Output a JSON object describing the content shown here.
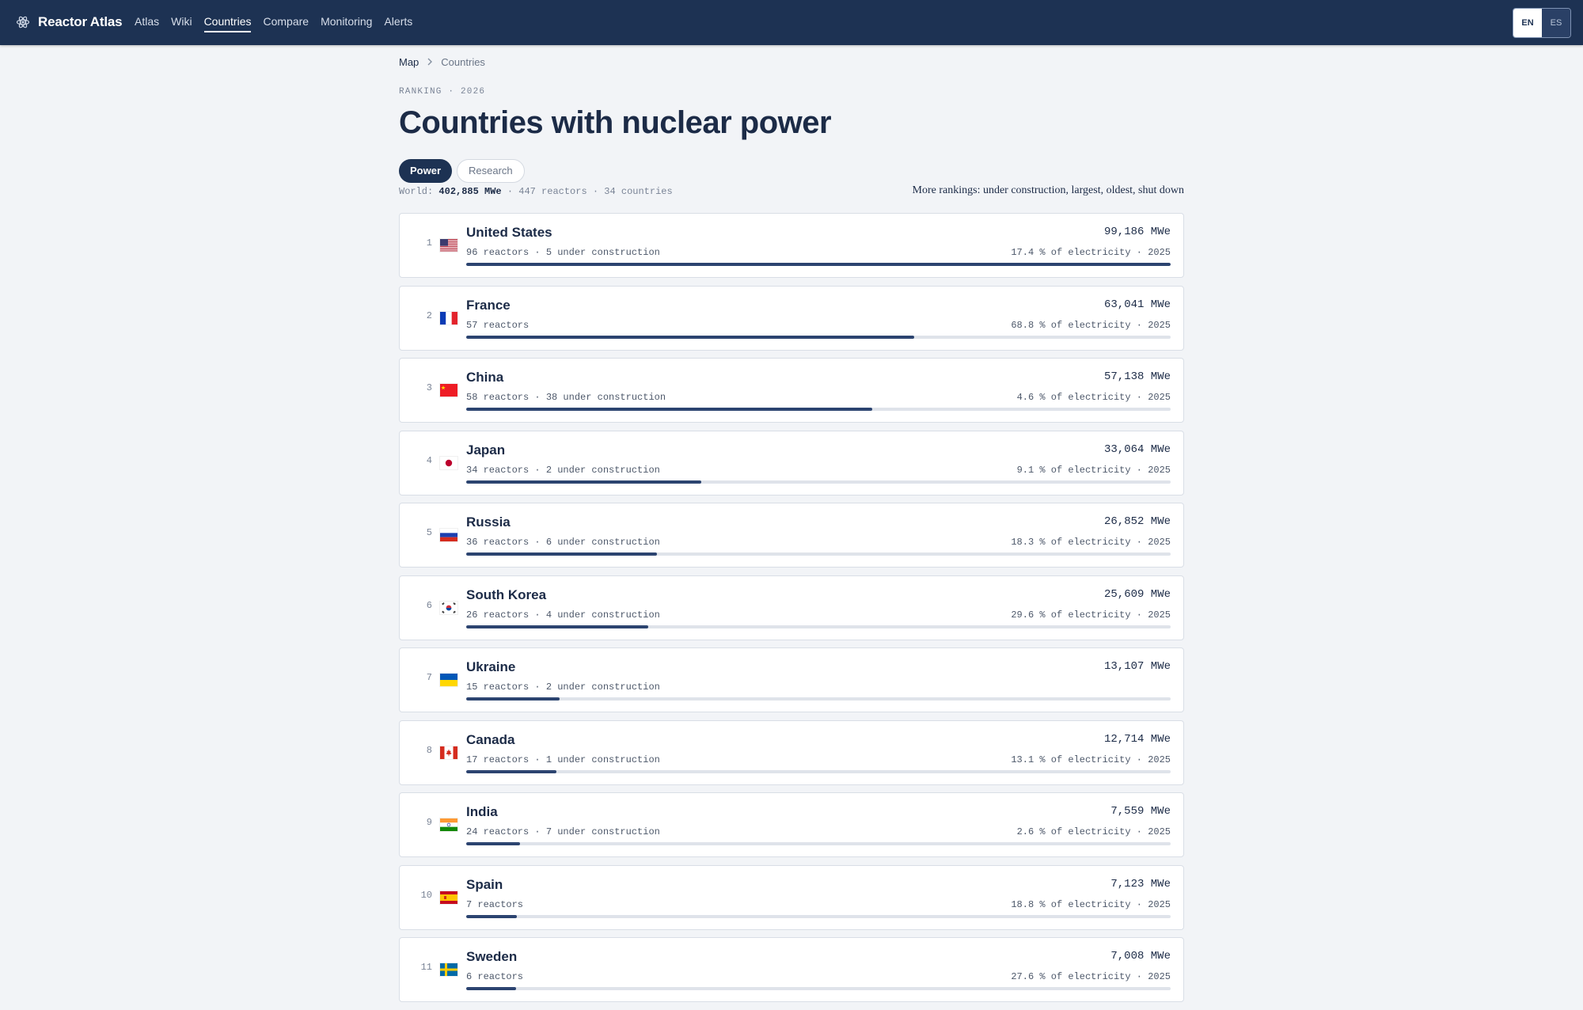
{
  "app": {
    "name": "Reactor Atlas",
    "logo_icon": "atom-icon"
  },
  "nav": [
    {
      "label": "Atlas",
      "active": false
    },
    {
      "label": "Wiki",
      "active": false
    },
    {
      "label": "Countries",
      "active": true
    },
    {
      "label": "Compare",
      "active": false
    },
    {
      "label": "Monitoring",
      "active": false
    },
    {
      "label": "Alerts",
      "active": false
    }
  ],
  "lang": {
    "selected": "EN",
    "other": "ES"
  },
  "breadcrumb": {
    "home": "Map",
    "current": "Countries"
  },
  "eyebrow": "RANKING · 2026",
  "title": "Countries with nuclear power",
  "tabs": [
    {
      "label": "Power",
      "active": true
    },
    {
      "label": "Research",
      "active": false
    }
  ],
  "world": {
    "prefix": "World: ",
    "total": "402,885 MWe",
    "rest": " · 447 reactors · 34 countries"
  },
  "more_rankings": "More rankings: under construction, largest, oldest, shut down",
  "colors": {
    "navbar": "#1d3253",
    "bar_fill": "#2c4470",
    "bar_track": "#dfe3ea",
    "background": "#f2f4f7"
  },
  "countries": [
    {
      "rank": "1",
      "name": "United States",
      "flag": "us",
      "mwe": "99,186 MWe",
      "reactors": "96 reactors · 5 under construction",
      "share": "17.4 % of electricity · 2025",
      "fraction": 1.0
    },
    {
      "rank": "2",
      "name": "France",
      "flag": "fr",
      "mwe": "63,041 MWe",
      "reactors": "57 reactors",
      "share": "68.8 % of electricity · 2025",
      "fraction": 0.6356
    },
    {
      "rank": "3",
      "name": "China",
      "flag": "cn",
      "mwe": "57,138 MWe",
      "reactors": "58 reactors · 38 under construction",
      "share": "4.6 % of electricity · 2025",
      "fraction": 0.5761
    },
    {
      "rank": "4",
      "name": "Japan",
      "flag": "jp",
      "mwe": "33,064 MWe",
      "reactors": "34 reactors · 2 under construction",
      "share": "9.1 % of electricity · 2025",
      "fraction": 0.3334
    },
    {
      "rank": "5",
      "name": "Russia",
      "flag": "ru",
      "mwe": "26,852 MWe",
      "reactors": "36 reactors · 6 under construction",
      "share": "18.3 % of electricity · 2025",
      "fraction": 0.2707
    },
    {
      "rank": "6",
      "name": "South Korea",
      "flag": "kr",
      "mwe": "25,609 MWe",
      "reactors": "26 reactors · 4 under construction",
      "share": "29.6 % of electricity · 2025",
      "fraction": 0.2582
    },
    {
      "rank": "7",
      "name": "Ukraine",
      "flag": "ua",
      "mwe": "13,107 MWe",
      "reactors": "15 reactors · 2 under construction",
      "share": "",
      "fraction": 0.1321
    },
    {
      "rank": "8",
      "name": "Canada",
      "flag": "ca",
      "mwe": "12,714 MWe",
      "reactors": "17 reactors · 1 under construction",
      "share": "13.1 % of electricity · 2025",
      "fraction": 0.1282
    },
    {
      "rank": "9",
      "name": "India",
      "flag": "in",
      "mwe": "7,559 MWe",
      "reactors": "24 reactors · 7 under construction",
      "share": "2.6 % of electricity · 2025",
      "fraction": 0.0762
    },
    {
      "rank": "10",
      "name": "Spain",
      "flag": "es",
      "mwe": "7,123 MWe",
      "reactors": "7 reactors",
      "share": "18.8 % of electricity · 2025",
      "fraction": 0.0718
    },
    {
      "rank": "11",
      "name": "Sweden",
      "flag": "se",
      "mwe": "7,008 MWe",
      "reactors": "6 reactors",
      "share": "27.6 % of electricity · 2025",
      "fraction": 0.0707
    }
  ]
}
